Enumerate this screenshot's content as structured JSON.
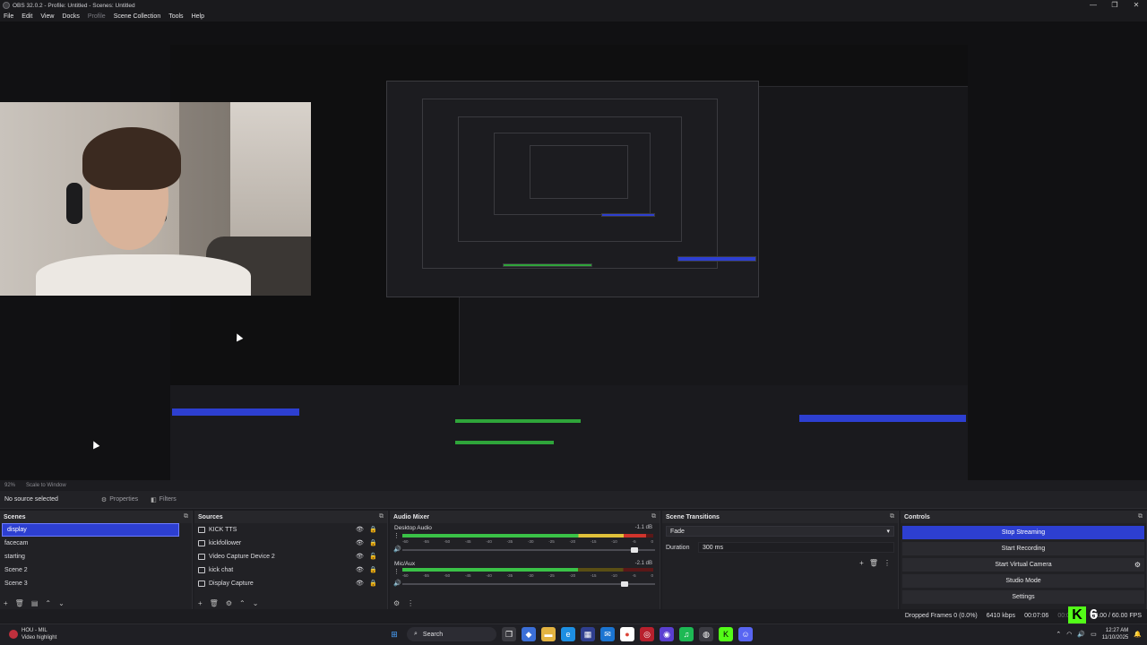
{
  "window": {
    "title": "OBS 32.0.2 - Profile: Untitled - Scenes: Untitled",
    "controls": [
      "—",
      "❐",
      "✕"
    ]
  },
  "menu": [
    "File",
    "Edit",
    "View",
    "Docks",
    "Profile",
    "Scene Collection",
    "Tools",
    "Help"
  ],
  "preview_bar": {
    "zoom": "92%",
    "scale": "Scale to Window"
  },
  "props_bar": {
    "no_source": "No source selected",
    "properties": "Properties",
    "filters": "Filters"
  },
  "scenes": {
    "title": "Scenes",
    "items": [
      "display",
      "facecam",
      "starting",
      "Scene 2",
      "Scene 3"
    ],
    "selected": "display"
  },
  "sources": {
    "title": "Sources",
    "items": [
      "KICK TTS",
      "kickfollower",
      "Video Capture Device 2",
      "kick chat",
      "Display Capture"
    ]
  },
  "audio_mixer": {
    "title": "Audio Mixer",
    "channels": [
      {
        "name": "Desktop Audio",
        "db": "-1.1 dB",
        "level": 0.97,
        "volume": 0.93
      },
      {
        "name": "Mic/Aux",
        "db": "-2.1 dB",
        "level": 0.7,
        "volume": 0.89
      }
    ],
    "ticks": [
      "-60",
      "-55",
      "-50",
      "-45",
      "-40",
      "-35",
      "-30",
      "-25",
      "-20",
      "-15",
      "-10",
      "-5",
      "0"
    ]
  },
  "transitions": {
    "title": "Scene Transitions",
    "type": "Fade",
    "duration_label": "Duration",
    "duration": "300 ms"
  },
  "controls": {
    "title": "Controls",
    "buttons": [
      "Stop Streaming",
      "Start Recording",
      "Start Virtual Camera",
      "Studio Mode",
      "Settings"
    ]
  },
  "status": {
    "dropped": "Dropped Frames 0 (0.0%)",
    "bitrate": "6410 kbps",
    "stream_time": "00:07:06",
    "rec_time": "00:00:00",
    "fps": "60.00 / 60.00 FPS"
  },
  "kick_overlay": {
    "count": "6"
  },
  "taskbar": {
    "user": "HOU - MIL",
    "subtitle": "Video highlight",
    "search": "Search",
    "time": "12:27 AM",
    "date": "11/10/2025"
  },
  "colors": {
    "accent": "#2d3fd1",
    "kick": "#53fc18",
    "background": "#1e1e22"
  }
}
